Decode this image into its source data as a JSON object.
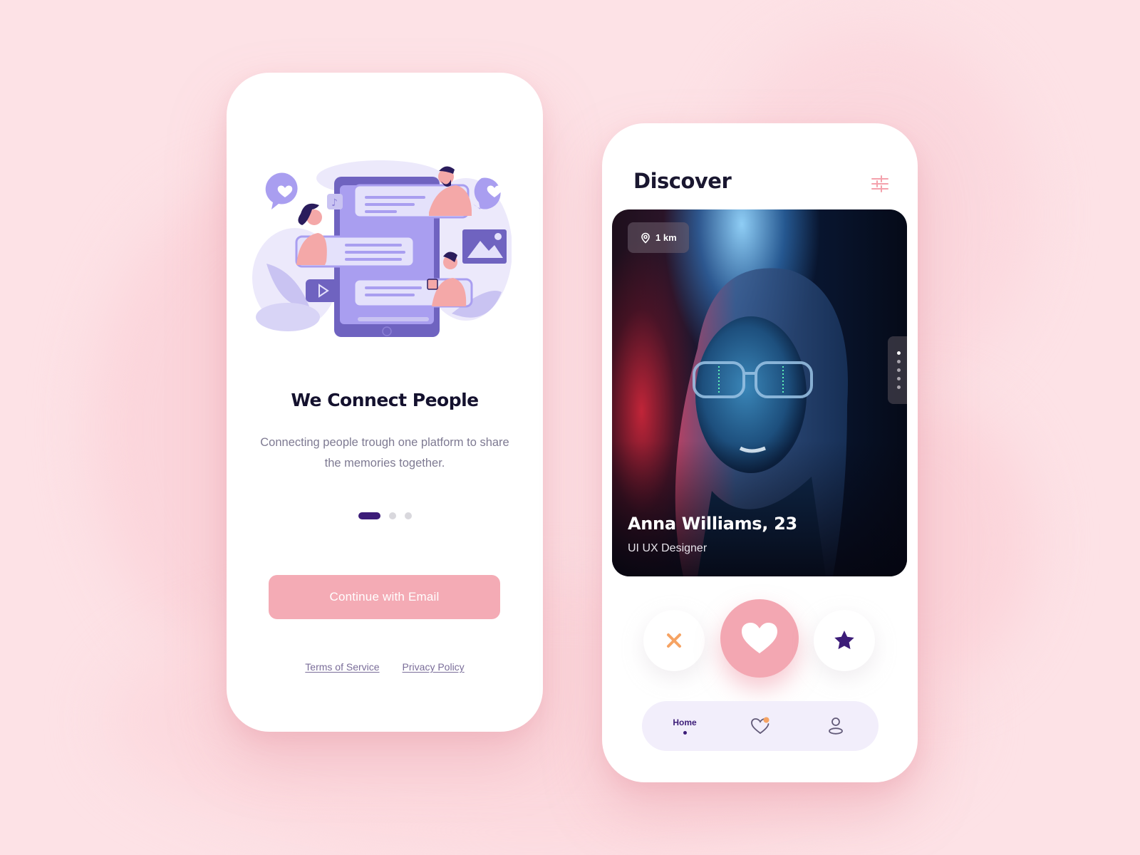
{
  "onboarding": {
    "title": "We Connect People",
    "description": "Connecting people trough one platform to share the memories together.",
    "pager": {
      "total": 3,
      "active_index": 0
    },
    "cta_label": "Continue with Email",
    "links": {
      "terms": "Terms of Service",
      "privacy": "Privacy Policy"
    }
  },
  "discover": {
    "title": "Discover",
    "filter_icon": "sliders-icon",
    "profile": {
      "distance": "1 km",
      "name": "Anna Williams, 23",
      "role": "UI UX Designer",
      "photo_count": 5,
      "active_photo_index": 0
    },
    "actions": {
      "skip_icon": "close-icon",
      "like_icon": "heart-icon",
      "superlike_icon": "star-icon"
    },
    "tabbar": {
      "tabs": [
        {
          "label": "Home",
          "icon": "home",
          "active": true
        },
        {
          "label": "",
          "icon": "heart-icon",
          "badge": true
        },
        {
          "label": "",
          "icon": "user-icon"
        }
      ]
    }
  },
  "colors": {
    "background": "#fde2e6",
    "accent_pink": "#f4abb5",
    "primary_purple": "#3c1c78",
    "skip_orange": "#f6a363",
    "tabbar_bg": "#f2eefb",
    "illustration_purple": "#a99ef0"
  }
}
